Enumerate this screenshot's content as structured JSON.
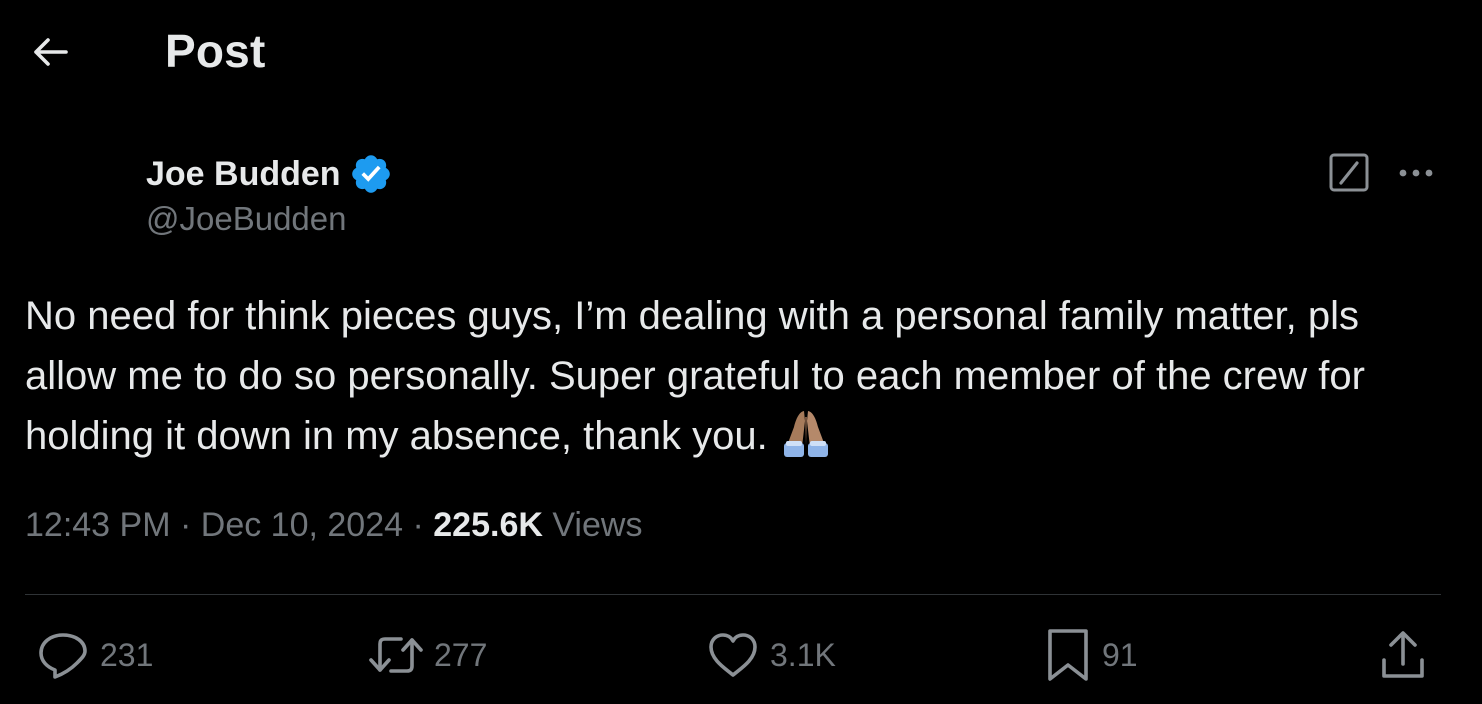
{
  "header": {
    "title": "Post",
    "back_icon": "arrow-left-icon"
  },
  "author": {
    "name": "Joe Budden",
    "handle": "@JoeBudden",
    "verified_color": "#1d9bf0"
  },
  "tweet": {
    "text": "No need for think pieces guys, I’m dealing with a personal family matter, pls allow me to do so personally. Super grateful to each member of the crew for holding it down in my absence, thank you.",
    "emoji": "folded-hands-emoji"
  },
  "meta": {
    "time": "12:43 PM",
    "separator": "·",
    "date": "Dec 10, 2024",
    "views_count": "225.6K",
    "views_label": "Views"
  },
  "actions": {
    "replies": "231",
    "reposts": "277",
    "likes": "3.1K",
    "bookmarks": "91"
  },
  "colors": {
    "background": "#000000",
    "text_primary": "#e7e9ea",
    "text_secondary": "#71767b",
    "divider": "#2f3336"
  }
}
